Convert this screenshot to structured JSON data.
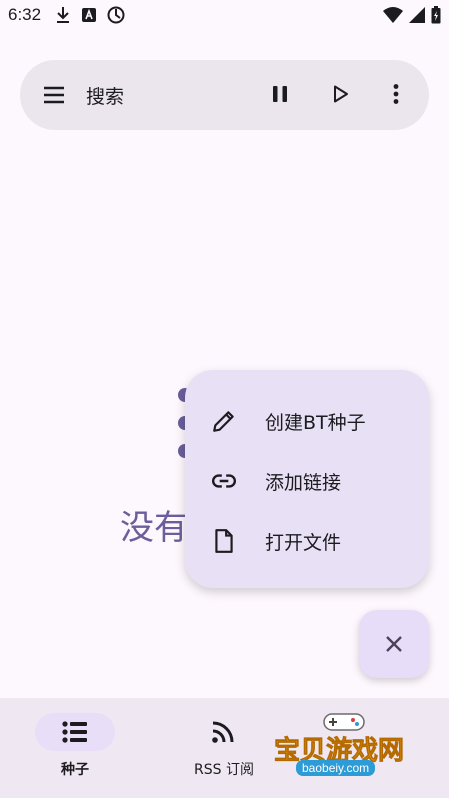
{
  "status_bar": {
    "time": "6:32"
  },
  "search_bar": {
    "placeholder": "搜索"
  },
  "empty_state": {
    "text": "没有"
  },
  "fab_menu": {
    "items": [
      {
        "label": "创建BT种子",
        "icon": "pencil-icon"
      },
      {
        "label": "添加链接",
        "icon": "link-icon"
      },
      {
        "label": "打开文件",
        "icon": "file-icon"
      }
    ]
  },
  "bottom_nav": {
    "items": [
      {
        "label": "种子",
        "icon": "list-icon",
        "selected": true
      },
      {
        "label": "RSS 订阅",
        "icon": "rss-icon",
        "selected": false
      }
    ]
  },
  "watermark": {
    "text": "宝贝游戏网",
    "url": "baobeiy.com"
  },
  "colors": {
    "accent": "#6a5f9a",
    "surface": "#fdf7fe",
    "menu_bg": "#e8e0f5"
  }
}
